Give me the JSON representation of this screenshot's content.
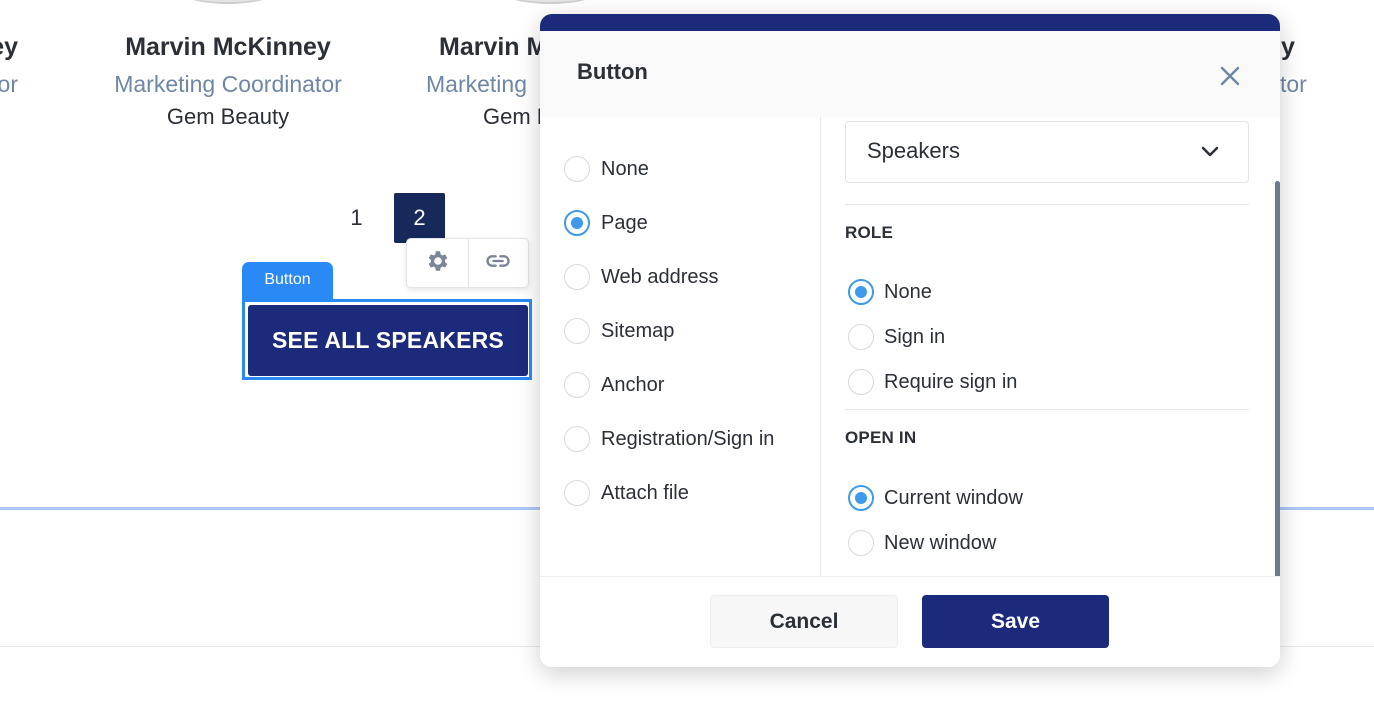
{
  "speakers": [
    {
      "name": "ey",
      "role": "tor",
      "company": ""
    },
    {
      "name": "Marvin McKinney",
      "role": "Marketing Coordinator",
      "company": "Gem Beauty"
    },
    {
      "name": "Marvin M",
      "role": "Marketing",
      "company": "Gem B"
    },
    {
      "name": "y",
      "role": "tor",
      "company": ""
    }
  ],
  "pagination": {
    "pages": [
      "1",
      "2"
    ],
    "current": "2"
  },
  "element_tag": "Button",
  "cta_label": "SEE ALL SPEAKERS",
  "modal": {
    "title": "Button",
    "link_types": [
      "None",
      "Page",
      "Web address",
      "Sitemap",
      "Anchor",
      "Registration/Sign in",
      "Attach file"
    ],
    "selected_link_type": "Page",
    "page_select": {
      "value": "Speakers"
    },
    "role": {
      "label": "ROLE",
      "options": [
        "None",
        "Sign in",
        "Require sign in"
      ],
      "selected": "None"
    },
    "open_in": {
      "label": "OPEN IN",
      "options": [
        "Current window",
        "New window"
      ],
      "selected": "Current window"
    },
    "cancel_label": "Cancel",
    "save_label": "Save"
  },
  "icons": [
    "gear-icon",
    "link-icon",
    "close-icon",
    "chevron-down-icon"
  ],
  "colors": {
    "primary": "#1c2a7c",
    "accent": "#2a8af5",
    "radio": "#3d9be9",
    "muted_text": "#6f87a6"
  }
}
